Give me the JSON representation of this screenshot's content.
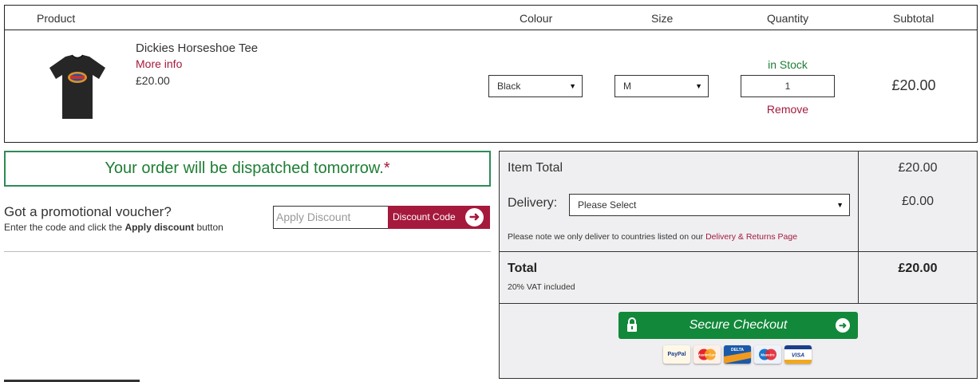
{
  "table": {
    "headers": {
      "product": "Product",
      "colour": "Colour",
      "size": "Size",
      "quantity": "Quantity",
      "subtotal": "Subtotal"
    },
    "item": {
      "name": "Dickies Horseshoe Tee",
      "more_info": "More info",
      "price": "£20.00",
      "colour": "Black",
      "size": "M",
      "quantity": "1",
      "stock": "in Stock",
      "remove": "Remove",
      "subtotal": "£20.00"
    }
  },
  "dispatch": {
    "text": "Your order will be dispatched tomorrow.",
    "asterisk": "*"
  },
  "promo": {
    "title": "Got a promotional voucher?",
    "sub_pre": "Enter the code and click the ",
    "sub_bold": "Apply discount",
    "sub_post": " button",
    "placeholder": "Apply Discount",
    "button": "Discount Code"
  },
  "summary": {
    "item_total_label": "Item Total",
    "item_total_value": "£20.00",
    "delivery_label": "Delivery:",
    "delivery_select": "Please Select",
    "delivery_value": "£0.00",
    "note_pre": "Please note we only deliver to countries listed on our ",
    "note_link": "Delivery & Returns Page",
    "total_label": "Total",
    "vat": "20% VAT included",
    "total_value": "£20.00",
    "checkout": "Secure Checkout"
  },
  "payment_cards": [
    "PayPal",
    "MasterCard",
    "DELTA",
    "Maestro",
    "VISA"
  ],
  "colors": {
    "accent_red": "#a5193c",
    "green": "#12883a",
    "panel_bg": "#efeff1"
  },
  "icons": {
    "select_arrow": "triangle-down",
    "discount_arrow": "arrow-right-circle",
    "lock": "padlock",
    "checkout_arrow": "arrow-right-circle"
  }
}
